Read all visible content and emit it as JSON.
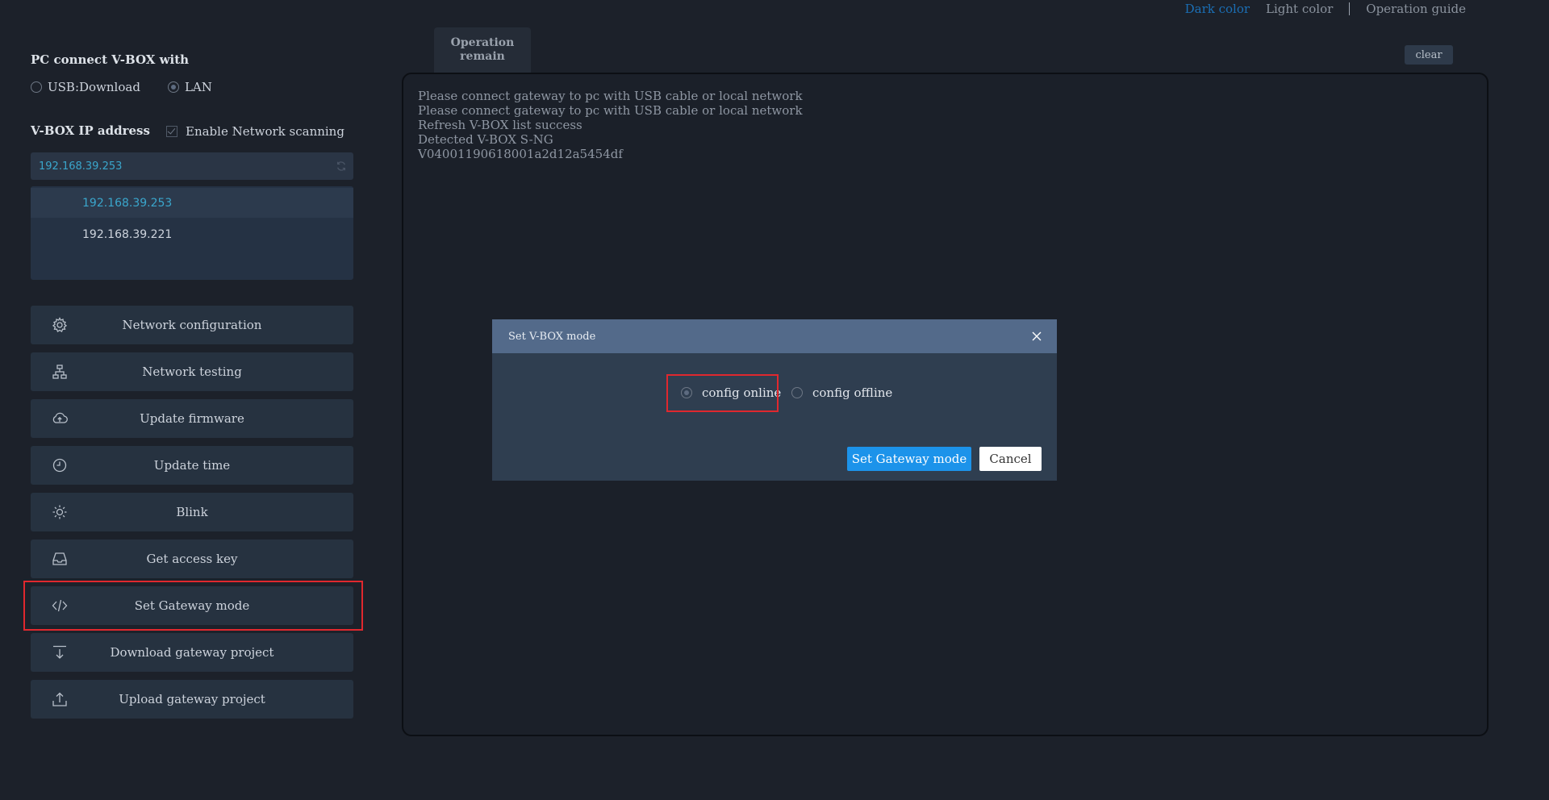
{
  "topbar": {
    "dark_color": "Dark color",
    "light_color": "Light color",
    "operation_guide": "Operation guide"
  },
  "connection": {
    "title": "PC connect V-BOX with",
    "options": [
      {
        "label": "USB:Download",
        "checked": false
      },
      {
        "label": "LAN",
        "checked": true
      }
    ]
  },
  "ip_section": {
    "title": "V-BOX IP address",
    "scan_label": "Enable Network scanning",
    "scan_checked": true,
    "current_ip": "192.168.39.253",
    "list": [
      "192.168.39.253",
      "192.168.39.221"
    ]
  },
  "actions": [
    {
      "label": "Network configuration",
      "icon": "gear-icon"
    },
    {
      "label": "Network testing",
      "icon": "network-icon"
    },
    {
      "label": "Update firmware",
      "icon": "cloud-upload-icon"
    },
    {
      "label": "Update time",
      "icon": "clock-icon"
    },
    {
      "label": "Blink",
      "icon": "sun-icon"
    },
    {
      "label": "Get access key",
      "icon": "inbox-icon"
    },
    {
      "label": "Set Gateway mode",
      "icon": "code-icon"
    },
    {
      "label": "Download gateway project",
      "icon": "download-icon"
    },
    {
      "label": "Upload gateway project",
      "icon": "upload-icon"
    }
  ],
  "log": {
    "tab_line1": "Operation",
    "tab_line2": "remain",
    "clear_label": "clear",
    "lines": [
      "Please connect gateway to pc with USB cable or local network",
      "Please connect gateway to pc with USB cable or local network",
      "Refresh V-BOX list success",
      "Detected V-BOX S-NG",
      "V04001190618001a2d12a5454df"
    ]
  },
  "modal": {
    "title": "Set V-BOX mode",
    "option_online": "config online",
    "option_offline": "config offline",
    "selected": "config online",
    "primary_label": "Set Gateway mode",
    "cancel_label": "Cancel"
  },
  "colors": {
    "highlight": "#e0282e",
    "primary": "#1c93ea",
    "accent": "#1b6fb5"
  }
}
